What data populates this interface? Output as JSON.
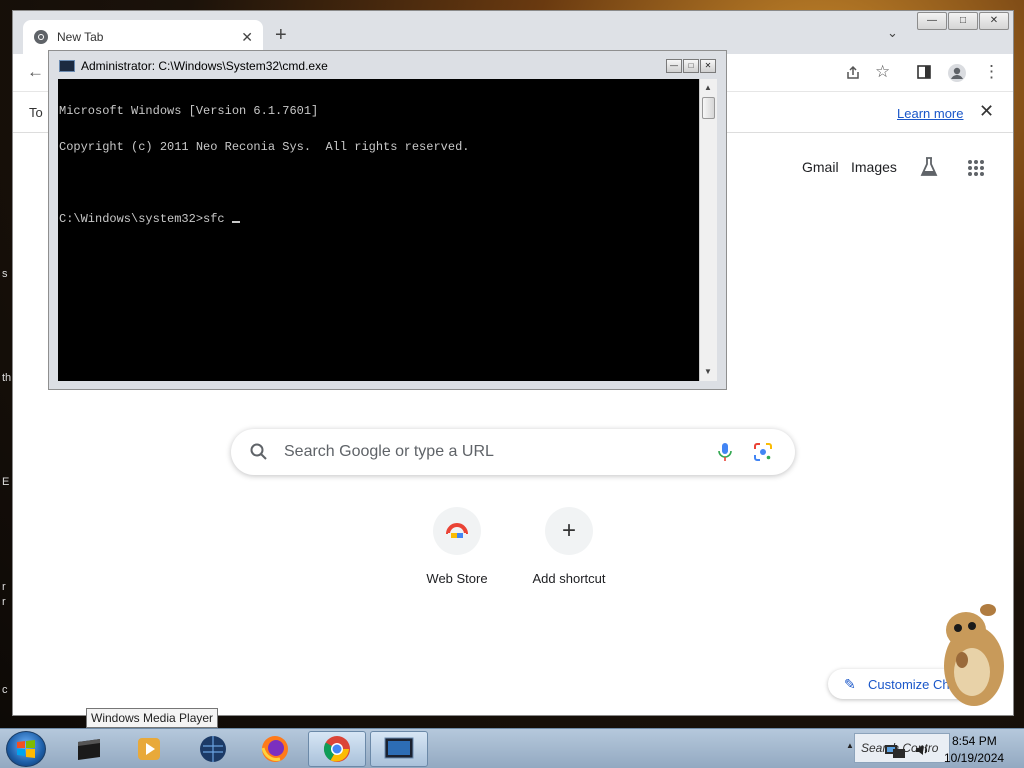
{
  "desktop": {
    "edge_texts": [
      "s",
      "th",
      "E",
      "r",
      "r",
      "c"
    ]
  },
  "chrome": {
    "tab_title": "New Tab",
    "tab_close": "✕",
    "new_tab": "+",
    "dropdown": "⌄",
    "window_controls": [
      "—",
      "□",
      "✕"
    ],
    "infobar": {
      "text": "To",
      "learn_more": "Learn more",
      "close": "✕"
    },
    "header_links": {
      "gmail": "Gmail",
      "images": "Images"
    },
    "search": {
      "placeholder": "Search Google or type a URL"
    },
    "shortcuts": [
      {
        "label": "Web Store",
        "icon": "web-store-icon"
      },
      {
        "label": "Add shortcut",
        "icon": "plus-icon",
        "glyph": "+"
      }
    ],
    "customize": {
      "label": "Customize Ch",
      "icon": "pencil-icon"
    }
  },
  "cmd": {
    "title": "Administrator: C:\\Windows\\System32\\cmd.exe",
    "controls": [
      "—",
      "□",
      "✕"
    ],
    "lines": [
      "Microsoft Windows [Version 6.1.7601]",
      "Copyright (c) 2011 Neo Reconia Sys.  All rights reserved.",
      "",
      "C:\\Windows\\system32>sfc "
    ]
  },
  "taskbar": {
    "tooltip": "Windows Media Player",
    "buttons": [
      {
        "name": "app-black-icon"
      },
      {
        "name": "windows-media-player-icon"
      },
      {
        "name": "globe-icon"
      },
      {
        "name": "firefox-icon"
      },
      {
        "name": "chrome-icon",
        "active": true
      },
      {
        "name": "cmd-icon",
        "active": true
      }
    ],
    "search_box": "Search Contro",
    "clock": {
      "time": "8:54 PM",
      "date": "10/19/2024"
    }
  },
  "colors": {
    "accent": "#1a57c9",
    "console_bg": "#000000",
    "console_fg": "#c8c8c8"
  }
}
